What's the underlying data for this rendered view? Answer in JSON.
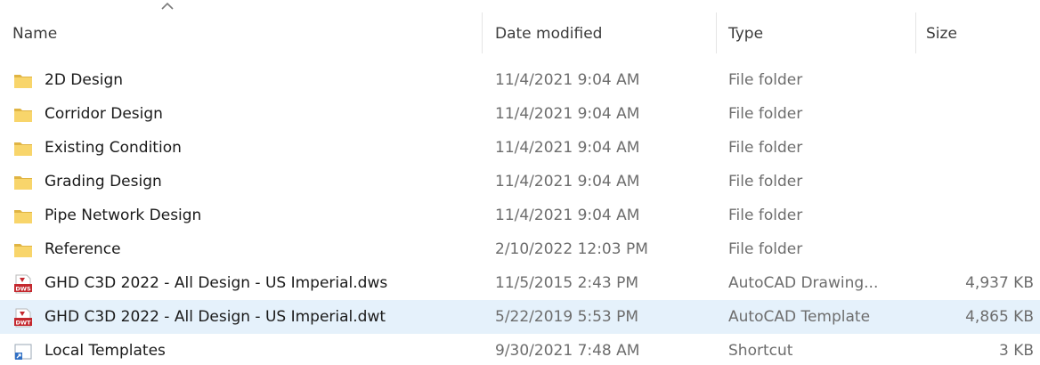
{
  "columns": {
    "name": "Name",
    "date_modified": "Date modified",
    "type": "Type",
    "size": "Size"
  },
  "sort": {
    "column": "name",
    "direction": "ascending",
    "icon": "chevron-up-icon"
  },
  "colors": {
    "folder": "#f8d56b",
    "folder_dark": "#e0b443",
    "dws_red": "#c4282e",
    "shortcut_blue": "#2f6fc4",
    "selection": "#e5f1fb"
  },
  "files": [
    {
      "name": "2D Design",
      "date": "11/4/2021 9:04 AM",
      "type": "File folder",
      "size": "",
      "icon": "folder-icon",
      "selected": false
    },
    {
      "name": "Corridor Design",
      "date": "11/4/2021 9:04 AM",
      "type": "File folder",
      "size": "",
      "icon": "folder-icon",
      "selected": false
    },
    {
      "name": "Existing Condition",
      "date": "11/4/2021 9:04 AM",
      "type": "File folder",
      "size": "",
      "icon": "folder-icon",
      "selected": false
    },
    {
      "name": "Grading Design",
      "date": "11/4/2021 9:04 AM",
      "type": "File folder",
      "size": "",
      "icon": "folder-icon",
      "selected": false
    },
    {
      "name": "Pipe Network Design",
      "date": "11/4/2021 9:04 AM",
      "type": "File folder",
      "size": "",
      "icon": "folder-icon",
      "selected": false
    },
    {
      "name": "Reference",
      "date": "2/10/2022 12:03 PM",
      "type": "File folder",
      "size": "",
      "icon": "folder-icon",
      "selected": false
    },
    {
      "name": "GHD C3D 2022 - All Design - US Imperial.dws",
      "date": "11/5/2015 2:43 PM",
      "type": "AutoCAD Drawing...",
      "size": "4,937 KB",
      "icon": "dws-file-icon",
      "badge": "DWS",
      "selected": false
    },
    {
      "name": "GHD C3D 2022 - All Design - US Imperial.dwt",
      "date": "5/22/2019 5:53 PM",
      "type": "AutoCAD Template",
      "size": "4,865 KB",
      "icon": "dwt-file-icon",
      "badge": "DWT",
      "selected": true
    },
    {
      "name": "Local Templates",
      "date": "9/30/2021 7:48 AM",
      "type": "Shortcut",
      "size": "3 KB",
      "icon": "shortcut-icon",
      "selected": false
    }
  ]
}
